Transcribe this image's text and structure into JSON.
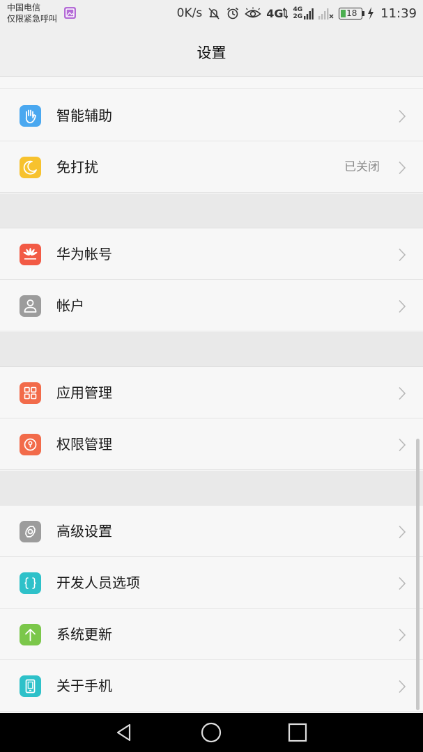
{
  "status_bar": {
    "carrier_line1": "中国电信",
    "carrier_line2": "仅限紧急呼叫",
    "net_speed": "0K/s",
    "network_primary": "4G",
    "network_secondary_top": "4G",
    "network_secondary_bottom": "2G",
    "battery_level": "18",
    "time": "11:39"
  },
  "header": {
    "title": "设置"
  },
  "settings_items": [
    {
      "label": "智能辅助",
      "icon": "hand-icon",
      "icon_color": "#4aa8f0"
    },
    {
      "label": "免打扰",
      "icon": "moon-icon",
      "icon_color": "#f7c22e",
      "value": "已关闭"
    },
    {
      "label": "华为帐号",
      "icon": "huawei-logo-icon",
      "icon_color": "#f25a45"
    },
    {
      "label": "帐户",
      "icon": "person-icon",
      "icon_color": "#9c9c9c"
    },
    {
      "label": "应用管理",
      "icon": "grid-icon",
      "icon_color": "#f26b4a"
    },
    {
      "label": "权限管理",
      "icon": "keyhole-icon",
      "icon_color": "#f26b4a"
    },
    {
      "label": "高级设置",
      "icon": "gear-icon",
      "icon_color": "#9c9c9c"
    },
    {
      "label": "开发人员选项",
      "icon": "braces-icon",
      "icon_color": "#2ec1c9"
    },
    {
      "label": "系统更新",
      "icon": "arrow-up-icon",
      "icon_color": "#7bc74a"
    },
    {
      "label": "关于手机",
      "icon": "phone-icon",
      "icon_color": "#2ec1c9"
    }
  ],
  "nav_bar": {
    "back": "back-icon",
    "home": "home-icon",
    "recents": "recents-icon"
  }
}
